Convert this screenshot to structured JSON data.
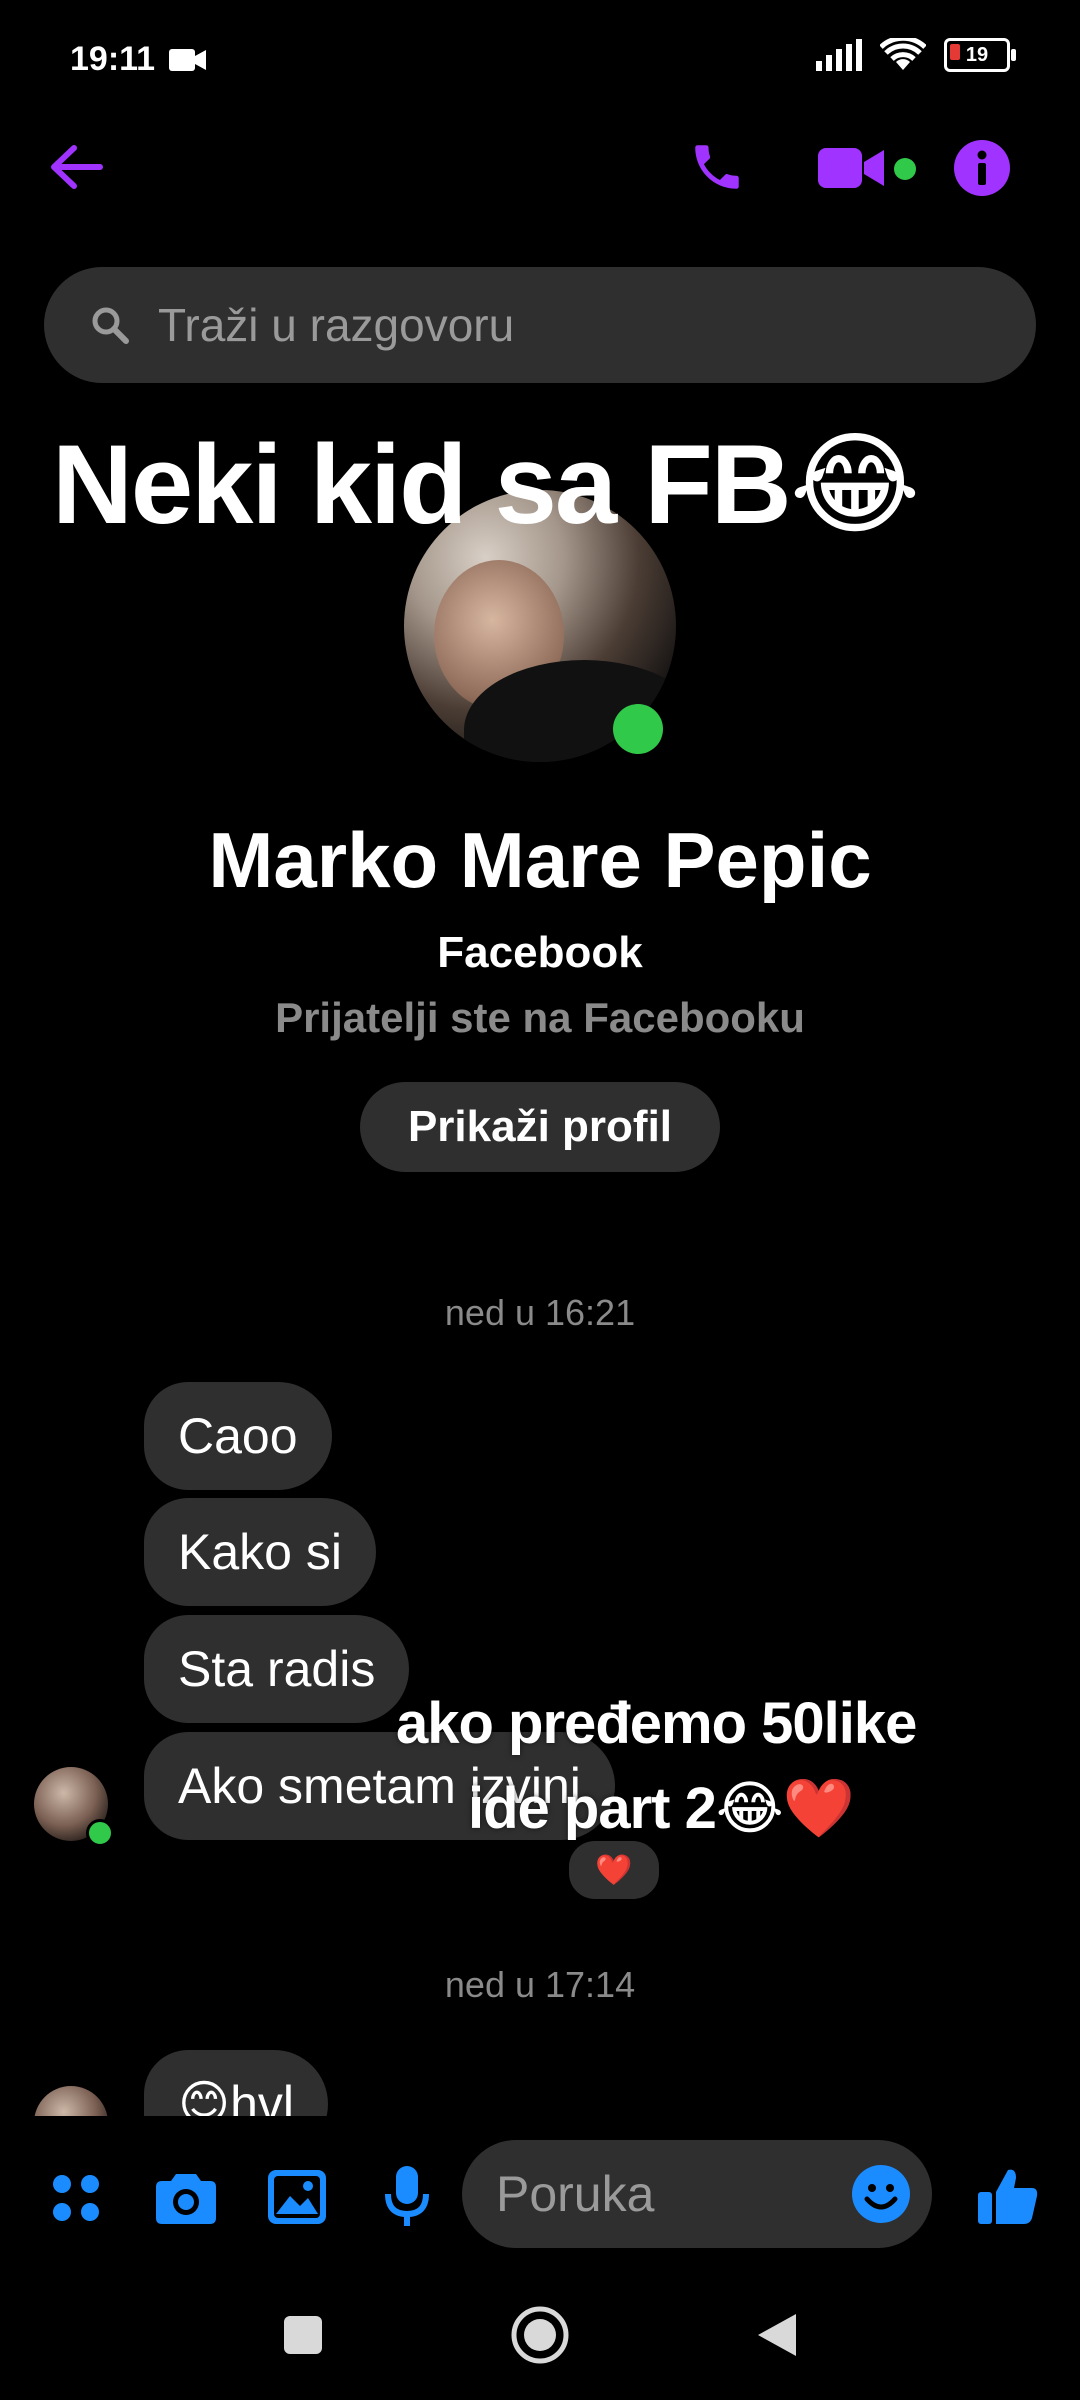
{
  "status_bar": {
    "time": "19:11",
    "battery": "19"
  },
  "header": {
    "search_placeholder": "Traži u razgovoru"
  },
  "overlay": {
    "title": "Neki kid sa FB😂",
    "caption_line1": "ako pređemo 50like",
    "caption_line2": "ide part 2😂❤️"
  },
  "profile": {
    "name": "Marko Mare Pepic",
    "platform": "Facebook",
    "relation": "Prijatelji ste na Facebooku",
    "view_profile_label": "Prikaži profil"
  },
  "messages": {
    "timestamp1": "ned u 16:21",
    "items": [
      "Caoo",
      "Kako si",
      "Sta radis",
      "Ako smetam izvini"
    ],
    "reaction": "❤️",
    "timestamp2": "ned u 17:14",
    "partial": "😊hvl"
  },
  "composer": {
    "placeholder": "Poruka"
  },
  "colors": {
    "accent": "#a033ff",
    "blue": "#1a8cff",
    "online": "#31c94a",
    "bubble": "#2f2f2f"
  }
}
